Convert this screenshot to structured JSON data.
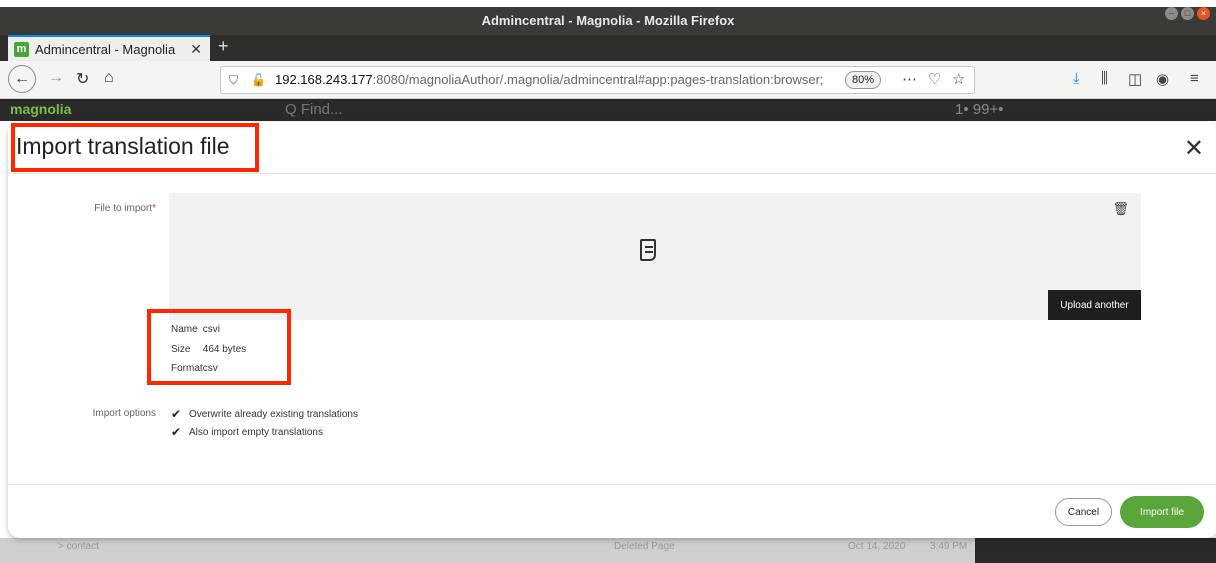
{
  "window": {
    "title": "Admincentral - Magnolia - Mozilla Firefox"
  },
  "browser": {
    "tab_label": "Admincentral - Magnolia",
    "tab_favicon": "m",
    "url_host": "192.168.243.177",
    "url_rest": ":8080/magnoliaAuthor/.magnolia/admincentral#app:pages-translation:browser;",
    "zoom": "80%"
  },
  "app": {
    "brand": "magnolia",
    "search_placeholder": "Q Find...",
    "header_right": "1•      99+•",
    "bottom_row": [
      "> contact",
      "Deleted Page",
      "Oct 14, 2020",
      "3:49 PM"
    ]
  },
  "dialog": {
    "title": "Import translation file",
    "file_label": "File to import",
    "required_mark": "*",
    "upload_another": "Upload another",
    "file_info": {
      "name_key": "Name",
      "name_value": "csvi",
      "size_key": "Size",
      "size_value": "464 bytes",
      "format_key": "Format",
      "format_value": "csv"
    },
    "options_label": "Import options",
    "options": [
      {
        "label": "Overwrite already existing translations",
        "checked": true
      },
      {
        "label": "Also import empty translations",
        "checked": true
      }
    ],
    "cancel": "Cancel",
    "import": "Import file"
  },
  "colors": {
    "highlight": "#ff2600",
    "primary": "#5aa63a",
    "brand": "#7ac143"
  }
}
